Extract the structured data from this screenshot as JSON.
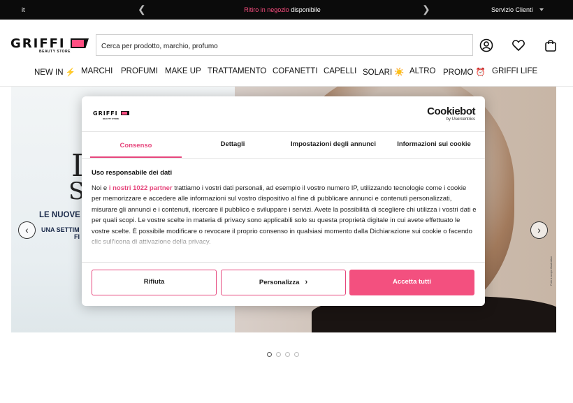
{
  "topbar": {
    "language": "it",
    "promo_highlight": "Ritiro in negozio",
    "promo_rest": " disponibile",
    "service": "Servizio Clienti",
    "prev_arrow": "❮",
    "next_arrow": "❯"
  },
  "header": {
    "logo_word": "GRIFFI",
    "logo_sub": "BEAUTY STORE",
    "search_placeholder": "Cerca per prodotto, marchio, profumo",
    "icons": [
      "account-icon",
      "wishlist-heart-icon",
      "cart-bag-icon"
    ]
  },
  "nav": {
    "items": [
      "NEW IN ⚡",
      "MARCHI",
      "PROFUMI",
      "MAKE UP",
      "TRATTAMENTO",
      "COFANETTI",
      "CAPELLI",
      "SOLARI ☀️",
      "ALTRO",
      "PROMO ⏰",
      "GRIFFI LIFE"
    ]
  },
  "hero": {
    "big_letter_1": "I",
    "big_letter_2": "S",
    "line1": "LE NUOVE",
    "line2": "UNA SETTIM",
    "line3": "FI",
    "side_note": "Foto a scopo illustrativo",
    "prev_arrow": "‹",
    "next_arrow": "›",
    "slides_total": 4,
    "slide_active": 1
  },
  "consent": {
    "logo_word": "GRIFFI",
    "logo_sub": "BEAUTY STORE",
    "brand": "Cookiebot",
    "brand_sub": "by Usercentrics",
    "tabs": [
      "Consenso",
      "Dettagli",
      "Impostazioni degli annunci",
      "Informazioni sui cookie"
    ],
    "active_tab": "Consenso",
    "heading": "Uso responsabile dei dati",
    "body_prefix": "Noi e ",
    "partners_link": "i nostri 1022 partner",
    "body_text": " trattiamo i vostri dati personali, ad esempio il vostro numero IP, utilizzando tecnologie come i cookie per memorizzare e accedere alle informazioni sul vostro dispositivo al fine di pubblicare annunci e contenuti personalizzati, misurare gli annunci e i contenuti, ricercare il pubblico e sviluppare i servizi. Avete la possibilità di scegliere chi utilizza i vostri dati e per quali scopi. Le vostre scelte in materia di privacy sono applicabili solo su questa proprietà digitale in cui avete effettuato le vostre scelte. È possibile modificare o revocare il proprio consenso in qualsiasi momento dalla Dichiarazione sui cookie o facendo clic sull'icona di attivazione della privacy.",
    "buttons": {
      "reject": "Rifiuta",
      "customize": "Personalizza",
      "customize_chevron": "›",
      "accept": "Accetta tutti"
    },
    "accent_color": "#e6467c"
  }
}
